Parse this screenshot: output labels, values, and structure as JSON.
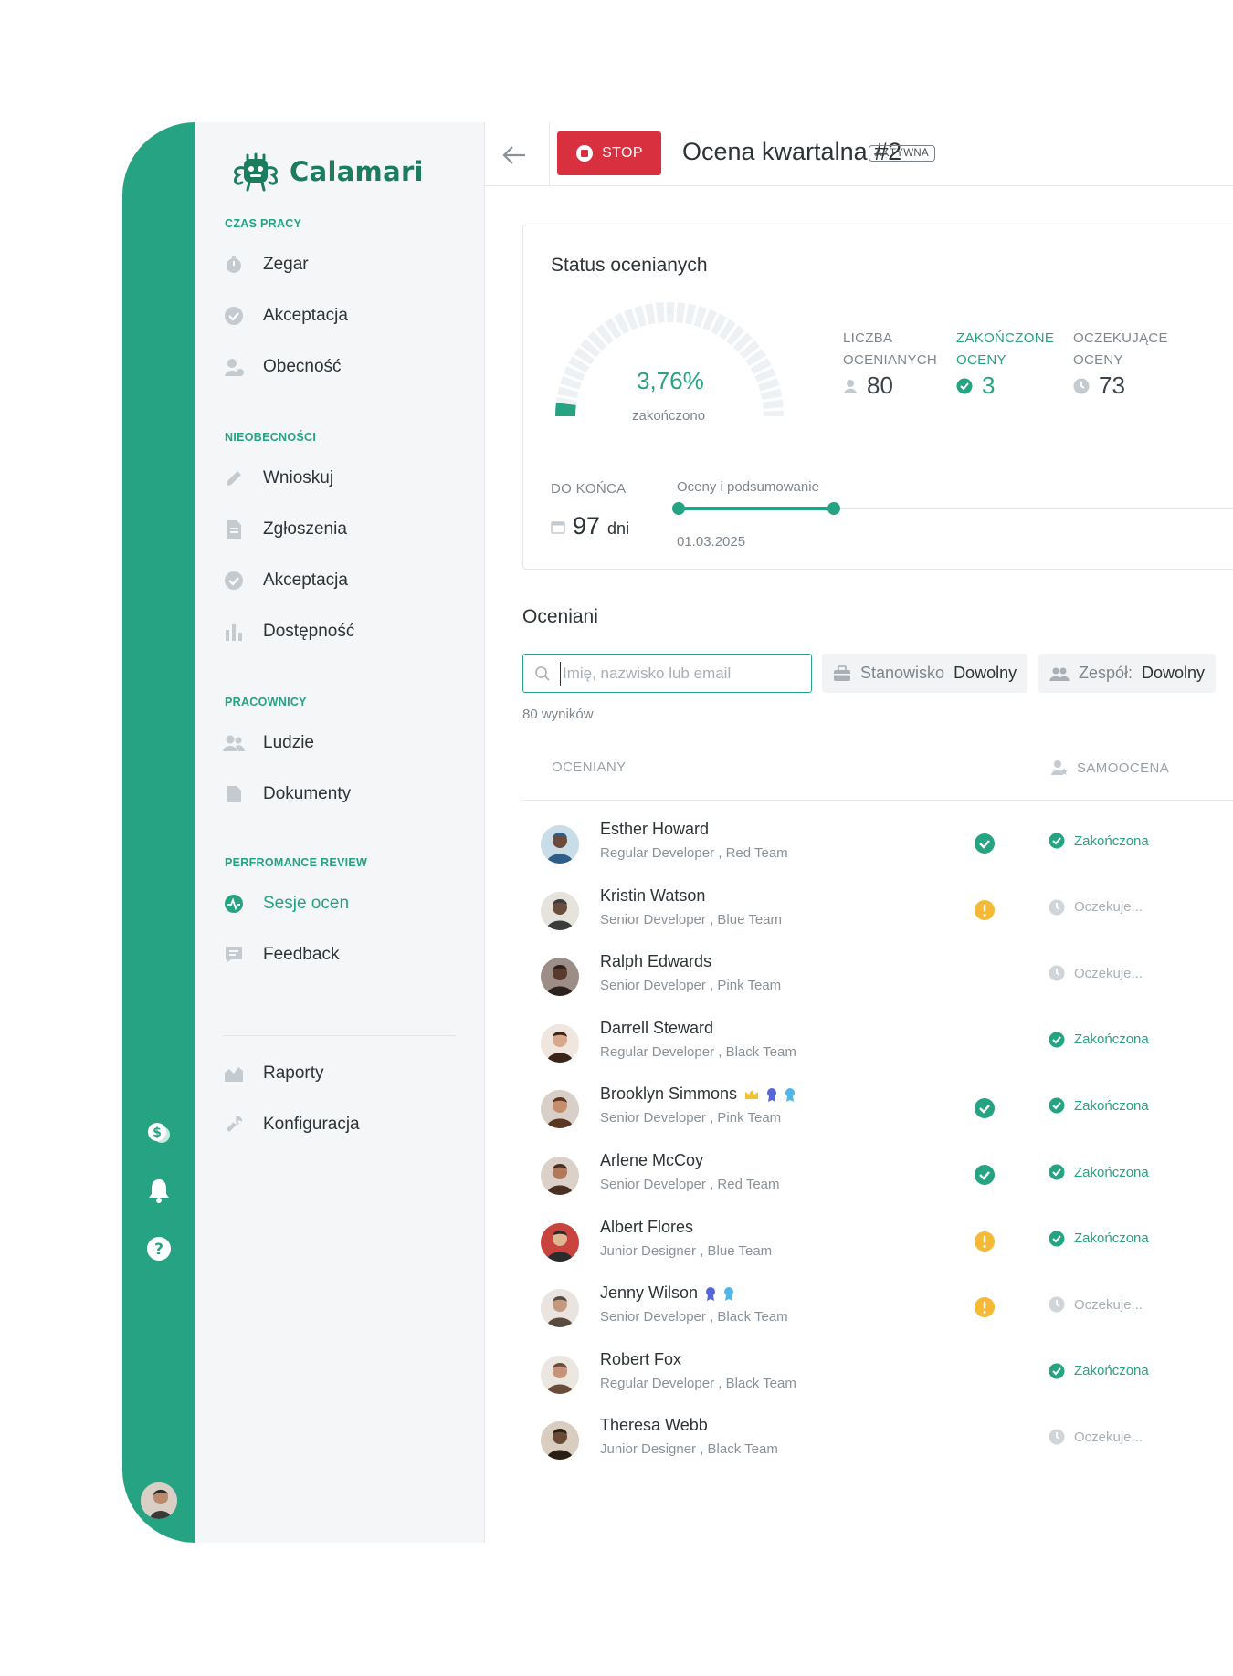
{
  "app": {
    "logo_text": "Calamari"
  },
  "sidebar": {
    "sections": [
      {
        "label": "CZAS PRACY",
        "items": [
          "Zegar",
          "Akceptacja",
          "Obecność"
        ]
      },
      {
        "label": "NIEOBECNOŚCI",
        "items": [
          "Wnioskuj",
          "Zgłoszenia",
          "Akceptacja",
          "Dostępność"
        ]
      },
      {
        "label": "PRACOWNICY",
        "items": [
          "Ludzie",
          "Dokumenty"
        ]
      },
      {
        "label": "PERFROMANCE REVIEW",
        "items": [
          "Sesje ocen",
          "Feedback"
        ]
      }
    ],
    "bottom_items": [
      "Raporty",
      "Konfiguracja"
    ],
    "active_item": "Sesje ocen"
  },
  "header": {
    "stop_label": "STOP",
    "title": "Ocena kwartalna #2",
    "status_badge": "AKTYWNA"
  },
  "status_card": {
    "title": "Status ocenianych",
    "progress_percent_text": "3,76%",
    "progress_fraction": 0.0376,
    "progress_sub": "zakończono",
    "stats": [
      {
        "label_line1": "LICZBA",
        "label_line2": "OCENIANYCH",
        "value": "80"
      },
      {
        "label_line1": "ZAKOŃCZONE",
        "label_line2": "OCENY",
        "value": "3"
      },
      {
        "label_line1": "OCZEKUJĄCE",
        "label_line2": "OCENY",
        "value": "73"
      }
    ],
    "remaining_label": "DO KOŃCA",
    "remaining_value": "97",
    "remaining_unit": "dni",
    "timeline_label": "Oceny i podsumowanie",
    "timeline_date": "01.03.2025"
  },
  "list": {
    "title": "Oceniani",
    "search_placeholder": "Imię, nazwisko lub email",
    "filters": [
      {
        "label": "Stanowisko",
        "value": "Dowolny"
      },
      {
        "label": "Zespół:",
        "value": "Dowolny"
      }
    ],
    "results_text": "80 wyników",
    "col_oceniany": "OCENIANY",
    "col_samoocena": "SAMOOCENA",
    "rows": [
      {
        "name": "Esther Howard",
        "role": "Regular Developer , Red Team",
        "mid": "done",
        "self": "done",
        "self_text": "Zakończona",
        "badges": []
      },
      {
        "name": "Kristin Watson",
        "role": "Senior Developer , Blue Team",
        "mid": "warn",
        "self": "wait",
        "self_text": "Oczekuje...",
        "badges": []
      },
      {
        "name": "Ralph Edwards",
        "role": "Senior Developer , Pink Team",
        "mid": "none",
        "self": "wait",
        "self_text": "Oczekuje...",
        "badges": []
      },
      {
        "name": "Darrell Steward",
        "role": "Regular Developer , Black Team",
        "mid": "none",
        "self": "done",
        "self_text": "Zakończona",
        "badges": []
      },
      {
        "name": "Brooklyn Simmons",
        "role": "Senior Developer , Pink Team",
        "mid": "done",
        "self": "done",
        "self_text": "Zakończona",
        "badges": [
          "crown",
          "medal-blue",
          "medal-lightblue"
        ]
      },
      {
        "name": "Arlene McCoy",
        "role": "Senior Developer , Red Team",
        "mid": "done",
        "self": "done",
        "self_text": "Zakończona",
        "badges": []
      },
      {
        "name": "Albert Flores",
        "role": "Junior Designer , Blue Team",
        "mid": "warn",
        "self": "done",
        "self_text": "Zakończona",
        "badges": []
      },
      {
        "name": "Jenny Wilson",
        "role": "Senior Developer , Black Team",
        "mid": "warn",
        "self": "wait",
        "self_text": "Oczekuje...",
        "badges": [
          "medal-blue",
          "medal-lightblue"
        ]
      },
      {
        "name": "Robert Fox",
        "role": "Regular Developer , Black Team",
        "mid": "none",
        "self": "done",
        "self_text": "Zakończona",
        "badges": []
      },
      {
        "name": "Theresa Webb",
        "role": "Junior Designer , Black Team",
        "mid": "none",
        "self": "wait",
        "self_text": "Oczekuje...",
        "badges": []
      }
    ]
  },
  "colors": {
    "accent": "#26a382",
    "stop": "#d8303e",
    "warning": "#f5b935",
    "muted": "#a8b0b5"
  }
}
